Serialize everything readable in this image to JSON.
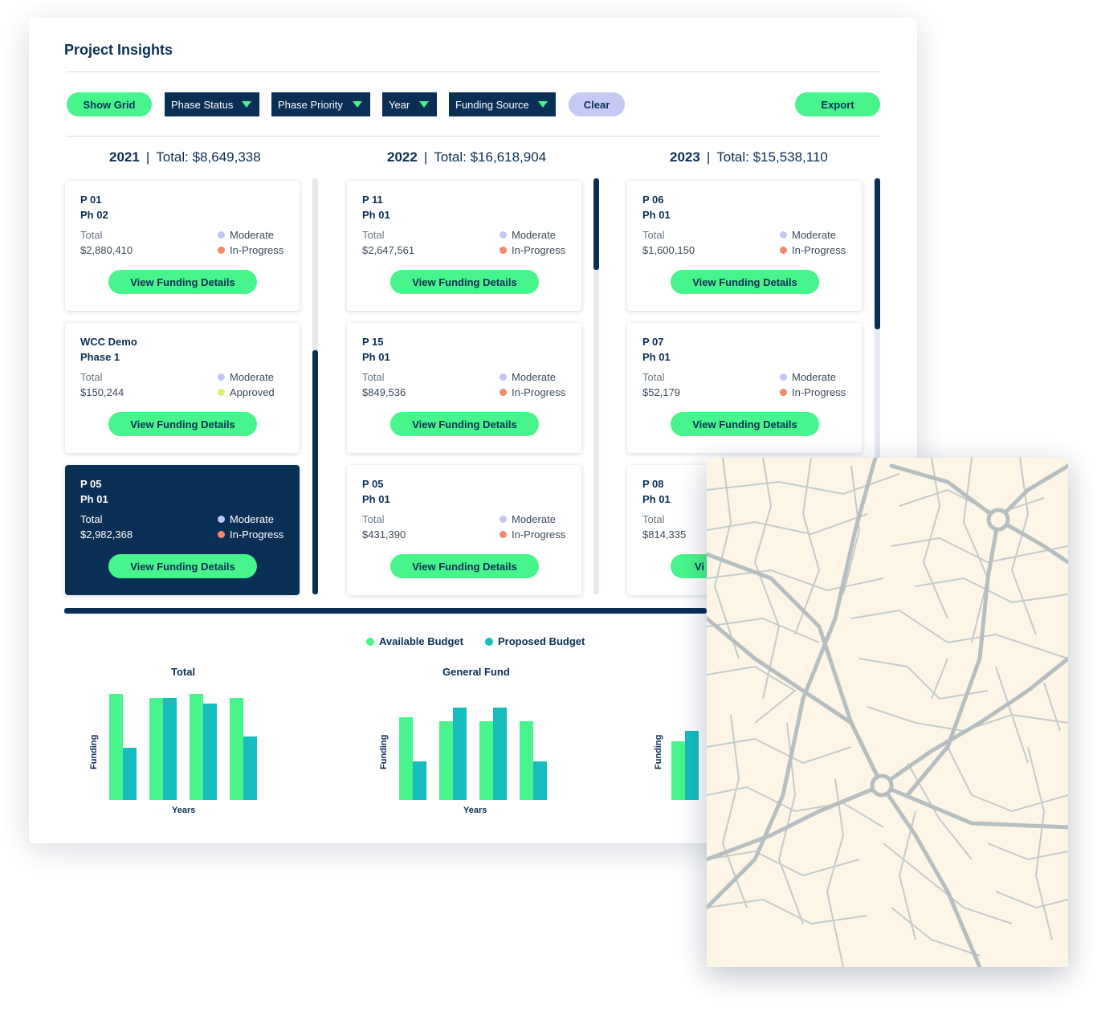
{
  "page": {
    "title": "Project Insights"
  },
  "toolbar": {
    "show_grid": "Show Grid",
    "phase_status": "Phase Status",
    "phase_priority": "Phase Priority",
    "year": "Year",
    "funding_source": "Funding Source",
    "clear": "Clear",
    "export": "Export"
  },
  "columns": [
    {
      "year": "2021",
      "total": "Total: $8,649,338",
      "cards": [
        {
          "t1": "P 01",
          "t2": "Ph 02",
          "label": "Total",
          "amount": "$2,880,410",
          "priority": "Moderate",
          "status": "In-Progress",
          "button": "View Funding Details"
        },
        {
          "t1": "WCC Demo",
          "t2": "Phase 1",
          "label": "Total",
          "amount": "$150,244",
          "priority": "Moderate",
          "status": "Approved",
          "button": "View Funding Details"
        },
        {
          "t1": "P 05",
          "t2": "Ph 01",
          "label": "Total",
          "amount": "$2,982,368",
          "priority": "Moderate",
          "status": "In-Progress",
          "button": "View Funding Details"
        }
      ]
    },
    {
      "year": "2022",
      "total": "Total: $16,618,904",
      "cards": [
        {
          "t1": "P 11",
          "t2": "Ph 01",
          "label": "Total",
          "amount": "$2,647,561",
          "priority": "Moderate",
          "status": "In-Progress",
          "button": "View Funding Details"
        },
        {
          "t1": "P 15",
          "t2": "Ph 01",
          "label": "Total",
          "amount": "$849,536",
          "priority": "Moderate",
          "status": "In-Progress",
          "button": "View Funding Details"
        },
        {
          "t1": "P 05",
          "t2": "Ph 01",
          "label": "Total",
          "amount": "$431,390",
          "priority": "Moderate",
          "status": "In-Progress",
          "button": "View Funding Details"
        }
      ]
    },
    {
      "year": "2023",
      "total": "Total: $15,538,110",
      "cards": [
        {
          "t1": "P 06",
          "t2": "Ph 01",
          "label": "Total",
          "amount": "$1,600,150",
          "priority": "Moderate",
          "status": "In-Progress",
          "button": "View Funding Details"
        },
        {
          "t1": "P 07",
          "t2": "Ph 01",
          "label": "Total",
          "amount": "$52,179",
          "priority": "Moderate",
          "status": "In-Progress",
          "button": "View Funding Details"
        },
        {
          "t1": "P 08",
          "t2": "Ph 01",
          "label": "Total",
          "amount": "$814,335",
          "priority": "",
          "status": "",
          "button": "Vi"
        }
      ]
    }
  ],
  "colors": {
    "navy": "#0a2f55",
    "accent_green": "#47f58c",
    "teal": "#17bcbc",
    "lavender": "#c6c9f3",
    "moderate_dot": "#c2c6f4",
    "in_progress_dot": "#f4876a",
    "approved_dot": "#e2ec6e",
    "map_background": "#fdf6e7",
    "map_roads": "#b6bec0"
  },
  "legend": {
    "available": "Available Budget",
    "proposed": "Proposed Budget"
  },
  "chart_data": [
    {
      "type": "bar",
      "title": "Total",
      "xlabel": "Years",
      "ylabel": "Funding",
      "series": [
        {
          "name": "Available Budget",
          "values": [
            100,
            96,
            100,
            96
          ]
        },
        {
          "name": "Proposed Budget",
          "values": [
            49,
            96,
            91,
            60
          ]
        }
      ],
      "ylim": [
        0,
        100
      ]
    },
    {
      "type": "bar",
      "title": "General Fund",
      "xlabel": "Years",
      "ylabel": "Funding",
      "series": [
        {
          "name": "Available Budget",
          "values": [
            78,
            74,
            74,
            74
          ]
        },
        {
          "name": "Proposed Budget",
          "values": [
            36,
            87,
            87,
            36
          ]
        }
      ],
      "ylim": [
        0,
        100
      ]
    },
    {
      "type": "bar",
      "title": "",
      "xlabel": "",
      "ylabel": "Funding",
      "series": [
        {
          "name": "Available Budget",
          "values": [
            55
          ]
        },
        {
          "name": "Proposed Budget",
          "values": [
            65
          ]
        }
      ],
      "ylim": [
        0,
        100
      ]
    }
  ]
}
